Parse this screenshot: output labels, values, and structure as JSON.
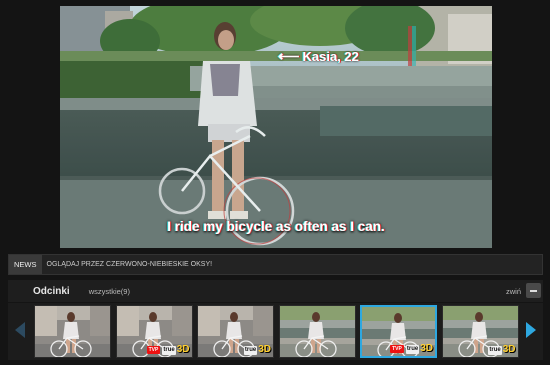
{
  "video": {
    "annotation": "Kasia, 22",
    "subtitle": "I ride my bicycle as often as I can."
  },
  "news": {
    "badge": "NEWS",
    "text": "OGLĄDAJ PRZEZ CZERWONO-NIEBIESKIE OKSY!"
  },
  "episodes": {
    "title": "Odcinki",
    "all_label": "wszystkie(9)",
    "collapse_label": "zwiń",
    "accent_color": "#2ea8e0",
    "thumbnails": [
      {
        "scene": "street",
        "badge": "",
        "active": false
      },
      {
        "scene": "street",
        "badge": "tvp true 3D",
        "active": false
      },
      {
        "scene": "street",
        "badge": "true 3D",
        "active": false
      },
      {
        "scene": "water",
        "badge": "",
        "active": false
      },
      {
        "scene": "water",
        "badge": "tvp true 3D",
        "active": true
      },
      {
        "scene": "water",
        "badge": "true 3D",
        "active": false
      }
    ],
    "badge_parts": {
      "tvp": "TVP",
      "true": "true",
      "three_d": "3D"
    }
  },
  "icons": {
    "prev": "chevron-left-icon",
    "next": "chevron-right-icon",
    "collapse": "minus-icon"
  }
}
